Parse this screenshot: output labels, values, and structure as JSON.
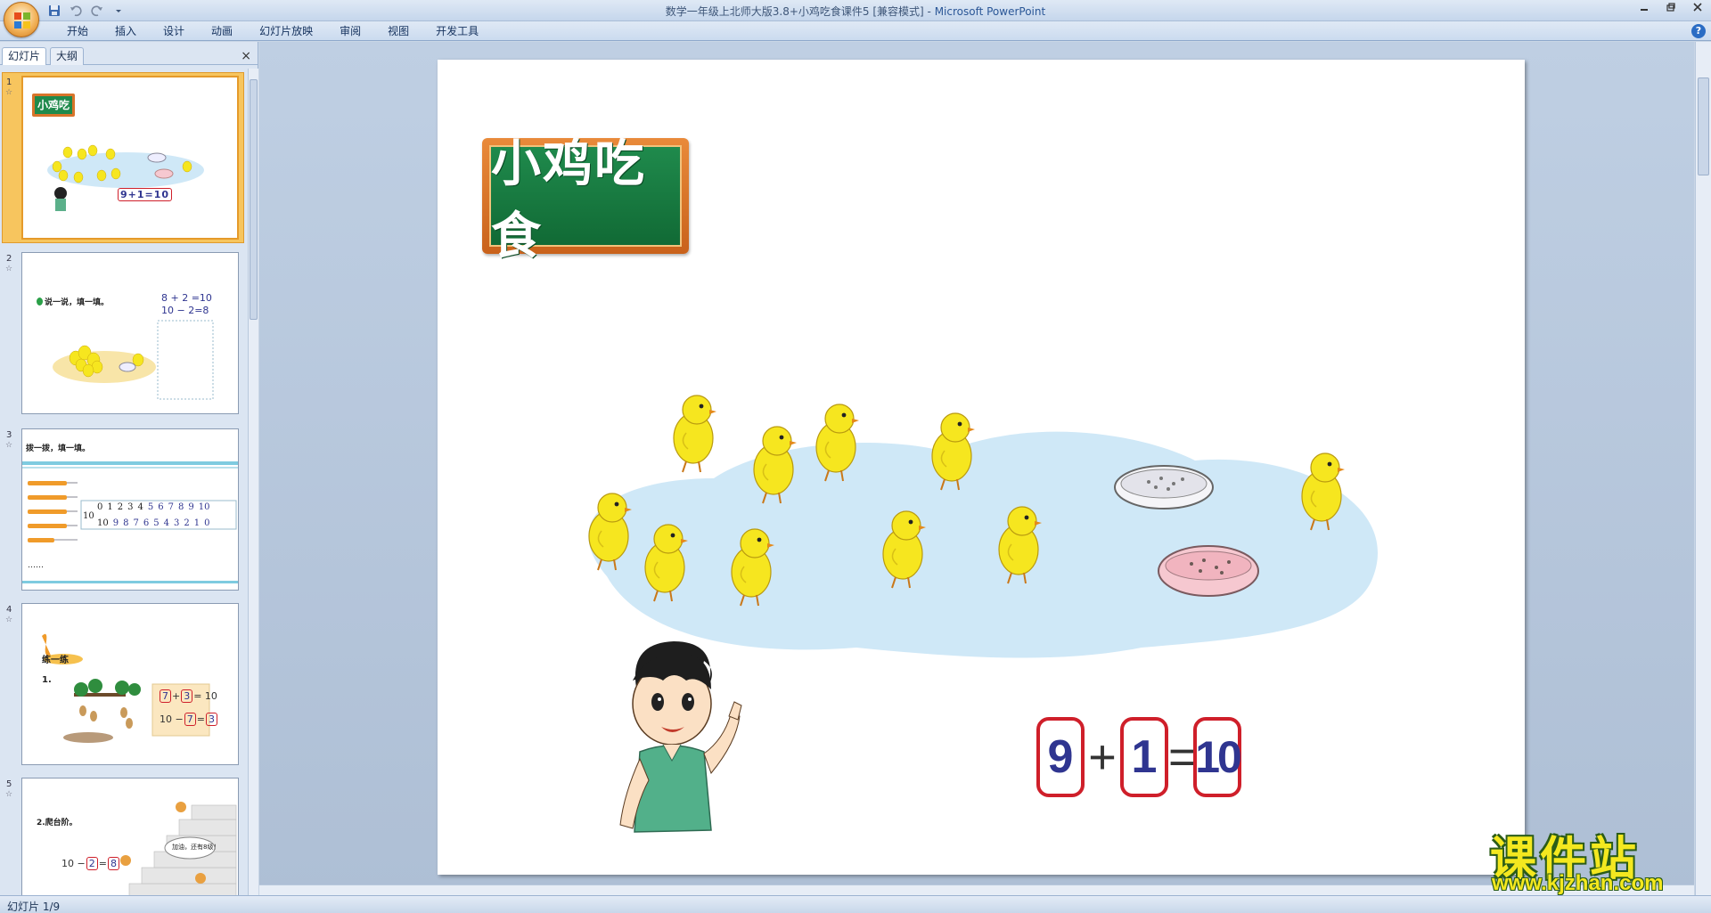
{
  "window": {
    "title": "数学一年级上北师大版3.8+小鸡吃食课件5 [兼容模式]",
    "title_separator": " - ",
    "app_name": "Microsoft PowerPoint",
    "controls": [
      "min",
      "restore",
      "close"
    ]
  },
  "quick_access": {
    "save_icon": "save-icon",
    "undo_icon": "undo-icon",
    "redo_icon": "redo-icon",
    "customize_icon": "dropdown-icon"
  },
  "ribbon": {
    "tabs": [
      "开始",
      "插入",
      "设计",
      "动画",
      "幻灯片放映",
      "审阅",
      "视图",
      "开发工具"
    ],
    "help": "?"
  },
  "left_pane": {
    "tab_slides": "幻灯片",
    "tab_outline": "大纲",
    "close": "×",
    "slides": [
      {
        "number": "1",
        "star": "☆",
        "selected": true
      },
      {
        "number": "2",
        "star": "☆",
        "selected": false
      },
      {
        "number": "3",
        "star": "☆",
        "selected": false
      },
      {
        "number": "4",
        "star": "☆",
        "selected": false
      },
      {
        "number": "5",
        "star": "☆",
        "selected": false
      }
    ],
    "thumb_text": {
      "s1_title": "小鸡吃食",
      "s1_eq": "9+1=10",
      "s2_title": "说一说，填一填。",
      "s2_eq1": "8 + 2 =10",
      "s2_eq2": "10 − 2=8",
      "s3_title": "拨一拨，填一填。",
      "s3_top": [
        "0",
        "1",
        "2",
        "3",
        "4",
        "5",
        "6",
        "7",
        "8",
        "9",
        "10"
      ],
      "s3_bottom": [
        "10",
        "9",
        "8",
        "7",
        "6",
        "5",
        "4",
        "3",
        "2",
        "1",
        "0"
      ],
      "s3_left": "10",
      "s3_dots": "……",
      "s4_title": "练一练",
      "s4_num": "1.",
      "s4_eq1_a": "7",
      "s4_eq1_op": "+",
      "s4_eq1_b": "3",
      "s4_eq1_rest": "= 10",
      "s4_eq2_pre": "10 −",
      "s4_eq2_a": "7",
      "s4_eq2_eq": "=",
      "s4_eq2_b": "3",
      "s5_title": "2.爬台阶。",
      "s5_eq_pre": "10 −",
      "s5_eq_a": "2",
      "s5_eq_eq": "=",
      "s5_eq_b": "8",
      "s5_bubble": "加油，还有8级！"
    }
  },
  "slide": {
    "title": "小鸡吃食",
    "equation": {
      "a": "9",
      "op": "+",
      "b": "1",
      "eq": "=",
      "result": "10"
    }
  },
  "status_bar": {
    "slide_counter": "幻灯片 1/9"
  },
  "watermark": {
    "big": "课件站",
    "small": "www.kjzhan.com"
  },
  "colors": {
    "equation_box_border": "#cf1f2a",
    "equation_digits": "#2f3590",
    "title_board_green": "#1f8a4c",
    "title_board_frame": "#d8742a",
    "pond": "#cfe8f7",
    "chick": "#f6e61f"
  }
}
